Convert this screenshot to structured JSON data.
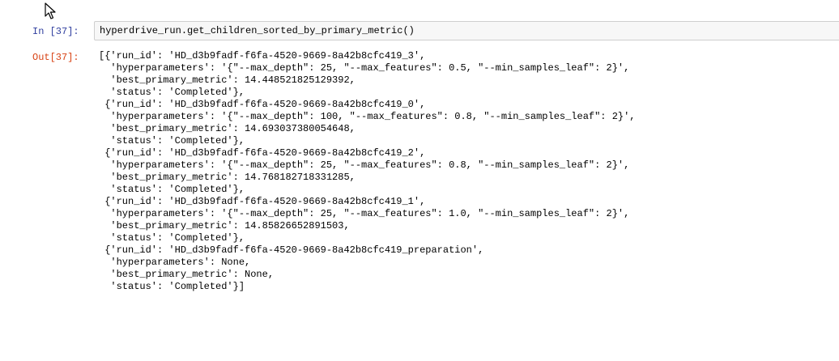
{
  "cell": {
    "in_prompt": "In [37]:",
    "code": "hyperdrive_run.get_children_sorted_by_primary_metric()",
    "out_prompt": "Out[37]:"
  },
  "output_lines": [
    "[{'run_id': 'HD_d3b9fadf-f6fa-4520-9669-8a42b8cfc419_3',",
    "  'hyperparameters': '{\"--max_depth\": 25, \"--max_features\": 0.5, \"--min_samples_leaf\": 2}',",
    "  'best_primary_metric': 14.448521825129392,",
    "  'status': 'Completed'},",
    " {'run_id': 'HD_d3b9fadf-f6fa-4520-9669-8a42b8cfc419_0',",
    "  'hyperparameters': '{\"--max_depth\": 100, \"--max_features\": 0.8, \"--min_samples_leaf\": 2}',",
    "  'best_primary_metric': 14.693037380054648,",
    "  'status': 'Completed'},",
    " {'run_id': 'HD_d3b9fadf-f6fa-4520-9669-8a42b8cfc419_2',",
    "  'hyperparameters': '{\"--max_depth\": 25, \"--max_features\": 0.8, \"--min_samples_leaf\": 2}',",
    "  'best_primary_metric': 14.768182718331285,",
    "  'status': 'Completed'},",
    " {'run_id': 'HD_d3b9fadf-f6fa-4520-9669-8a42b8cfc419_1',",
    "  'hyperparameters': '{\"--max_depth\": 25, \"--max_features\": 1.0, \"--min_samples_leaf\": 2}',",
    "  'best_primary_metric': 14.85826652891503,",
    "  'status': 'Completed'},",
    " {'run_id': 'HD_d3b9fadf-f6fa-4520-9669-8a42b8cfc419_preparation',",
    "  'hyperparameters': None,",
    "  'best_primary_metric': None,",
    "  'status': 'Completed'}]"
  ]
}
